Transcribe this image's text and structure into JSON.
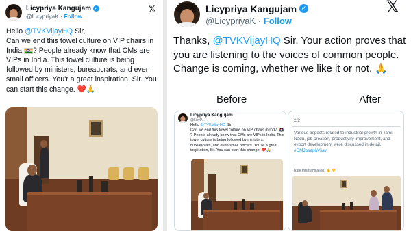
{
  "left_tweet": {
    "author_name": "Licypriya Kangujam",
    "verified_badge": "✓",
    "handle": "@LicypriyaK",
    "separator": "·",
    "follow_label": "Follow",
    "x_logo": "𝕏",
    "text": {
      "greeting": "Hello ",
      "mention": "@TVKVijayHQ",
      "after_mention": " Sir,",
      "line2": "Can we end this towel culture on VIP chairs in India",
      "after_flag": "? People already know that CMs are VIPs in India. This towel culture is being followed by ministers, bureaucrats, and even small officers. You'r a great inspiration, Sir. You can start this change.",
      "emoji": "❤️🙏"
    }
  },
  "right_tweet": {
    "author_name": "Licypriya Kangujam",
    "verified_badge": "✓",
    "handle": "@LicypriyaK",
    "separator": "·",
    "follow_label": "Follow",
    "x_logo": "𝕏",
    "text": {
      "before_mention": "Thanks, ",
      "mention": "@TVKVijayHQ",
      "after_mention": " Sir. Your action proves that you are listening to the voices of common people. Change is coming, whether we like it or not.",
      "emoji": "🙏"
    },
    "before_label": "Before",
    "after_label": "After",
    "embed_before": {
      "author_name": "Licypriya Kangujam",
      "handle": "@LicyP...",
      "greeting": "Hello ",
      "mention": "@TVKVijayHQ",
      "after_mention": " Sir,",
      "body1": "Can we end this towel culture on VIP chairs in India",
      "body2": "? People already know that CMs are VIPs in India. This towel culture is being followed by ministers, bureaucrats, and even small officers. You're a great inspiration, Sir. You can start this change.",
      "emoji": "❤️🙏"
    },
    "embed_after": {
      "page_indicator": "2/2",
      "body": "Various aspects related to industrial growth in Tamil Nadu, job creation, productivity improvement, and export development were discussed in detail.",
      "hashtag": "#CMJosephVijay",
      "rate_translation": "Rate this translation:"
    }
  },
  "colors": {
    "link": "#1d9bf0",
    "text": "#0f1419",
    "muted": "#536471",
    "divider_bg": "#e9e9e9"
  }
}
